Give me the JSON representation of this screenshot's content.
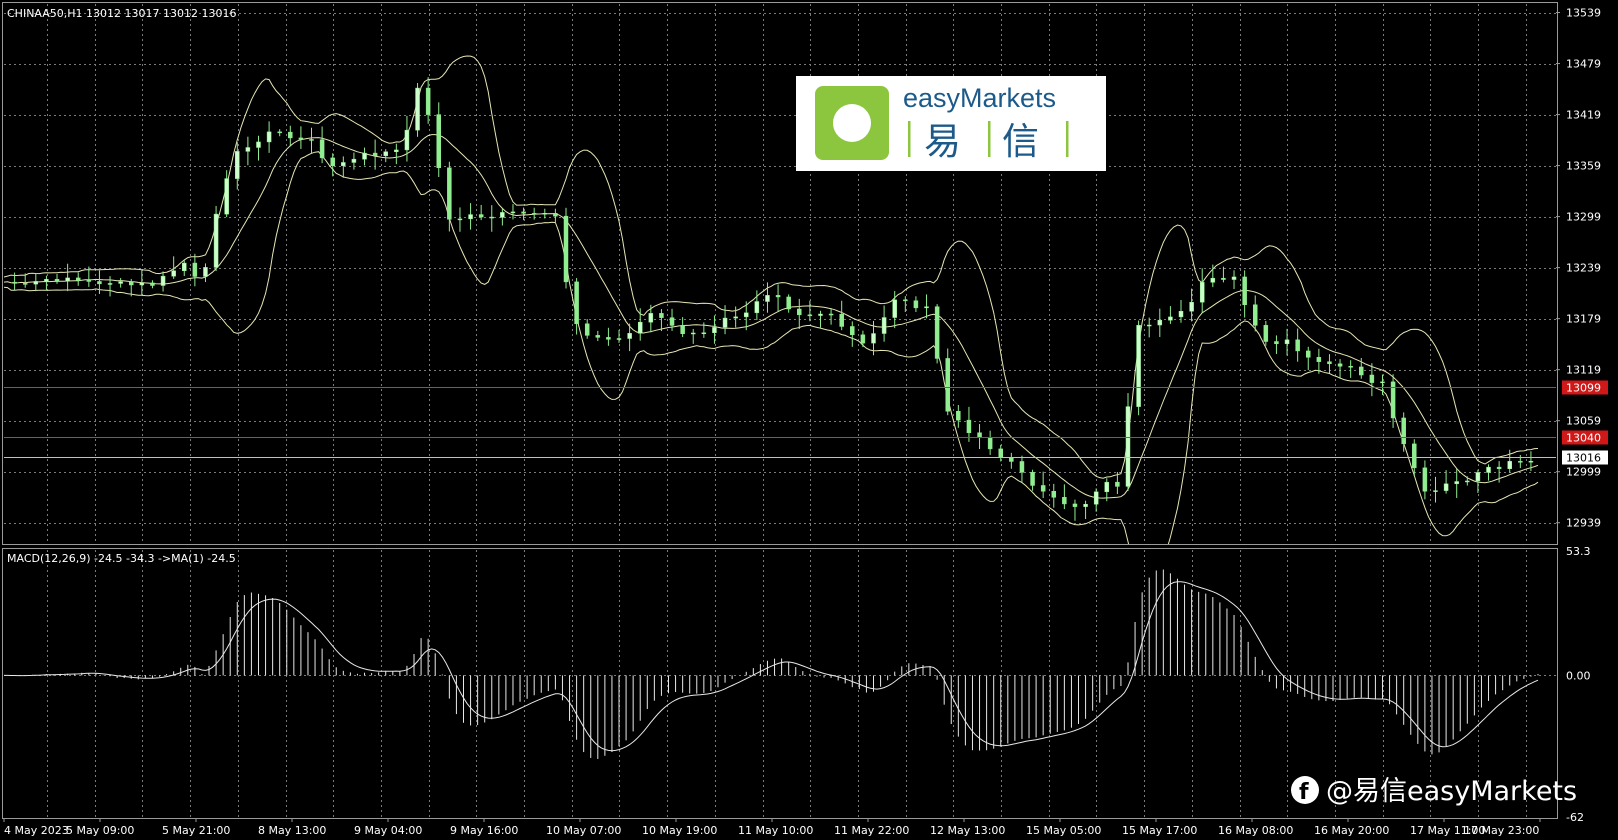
{
  "price_panel": {
    "header": "CHINAA50,H1  13012 13017 13012 13016",
    "axis_ticks": [
      "13539",
      "13479",
      "13419",
      "13359",
      "13299",
      "13239",
      "13179",
      "13119",
      "13059",
      "12999",
      "12939"
    ],
    "hlines": [
      {
        "price": 13099,
        "label": "13099",
        "color": "#ff2020"
      },
      {
        "price": 13040,
        "label": "13040",
        "color": "#ff2020"
      },
      {
        "price": 13016,
        "label": "13016",
        "color": "#c0c0c0"
      }
    ]
  },
  "macd_panel": {
    "header": "MACD(12,26,9) -24.5 -34.3  ->MA(1) -24.5",
    "axis_ticks": [
      "53.3",
      "0.00",
      "-62"
    ]
  },
  "time_axis": [
    "4 May 2023",
    "5 May 09:00",
    "5 May 21:00",
    "8 May 13:00",
    "9 May 04:00",
    "9 May 16:00",
    "10 May 07:00",
    "10 May 19:00",
    "11 May 10:00",
    "11 May 22:00",
    "12 May 13:00",
    "15 May 05:00",
    "15 May 17:00",
    "16 May 08:00",
    "16 May 20:00",
    "17 May 11:00",
    "17 May 23:00"
  ],
  "logo": {
    "brand": "easyMarkets",
    "chinese": "易信",
    "char1": "易",
    "char2": "信"
  },
  "watermark": {
    "text": "@易信easyMarkets",
    "platform_icon": "facebook-icon"
  },
  "colors": {
    "background": "#000000",
    "grid": "#7a7a7a",
    "bull_candle": "#ccffcc",
    "bear_candle": "#90ee90",
    "bands": "#e6e6b4",
    "macd": "#e8e8e8",
    "logo_green": "#8cc63f",
    "logo_blue": "#1c5a8a"
  }
}
